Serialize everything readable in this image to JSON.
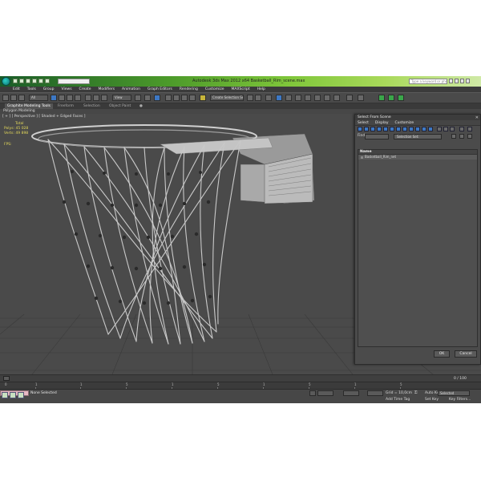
{
  "window": {
    "title": "Autodesk 3ds Max  2012 x64      Basketball_Rim_scene.max",
    "workspace": "",
    "search_placeholder": "Type a keyword or phrase"
  },
  "menu": [
    "Edit",
    "Tools",
    "Group",
    "Views",
    "Create",
    "Modifiers",
    "Animation",
    "Graph Editors",
    "Rendering",
    "Customize",
    "MAXScript",
    "Help"
  ],
  "toolbar": {
    "filter_select": "All",
    "view_select": "View",
    "selection_set": "Create Selection Se"
  },
  "ribbon": {
    "tabs": [
      "Graphite Modeling Tools",
      "Freeform",
      "Selection",
      "Object Paint"
    ],
    "active_tab": "Graphite Modeling Tools",
    "panel": "Polygon Modeling"
  },
  "viewport": {
    "label": "[ + ] [ Perspective ] [ Shaded + Edged Faces ]",
    "stats_header": "Total",
    "polys_label": "Polys:",
    "polys_value": "45 028",
    "verts_label": "Verts:",
    "verts_value": "49 898",
    "fps_label": "FPS:"
  },
  "dialog": {
    "title": "Select From Scene",
    "close": "✕",
    "tabs": [
      "Select",
      "Display",
      "Customize"
    ],
    "find_label": "Find:",
    "selection_set_label": "Selection Set:",
    "column_name": "Name",
    "items": [
      "Basketball_Rim_net"
    ],
    "ok": "OK",
    "cancel": "Cancel"
  },
  "timeline": {
    "counter": "0 / 100",
    "ticks": [
      "0",
      "1",
      "5",
      "10",
      "15",
      "20",
      "25",
      "30",
      "35",
      "40",
      "45",
      "50",
      "55",
      "60",
      "65",
      "70",
      "75",
      "80",
      "85",
      "90"
    ]
  },
  "status": {
    "selection": "None Selected",
    "x": "",
    "y": "",
    "z": "",
    "grid": "Grid = 10,0cm",
    "auto_key": "Auto Key",
    "auto_key_value": "Selected",
    "set_key": "Set Key",
    "key_filters": "Key Filters...",
    "add_time_tag": "Add Time Tag"
  },
  "colors": {
    "title_gradient_start": "#1a5c28",
    "title_gradient_end": "#cfe9a6",
    "viewport_bg": "#4a4a4a",
    "stats_yellow": "#e3d85a",
    "accent_blue": "#3d78c4"
  }
}
